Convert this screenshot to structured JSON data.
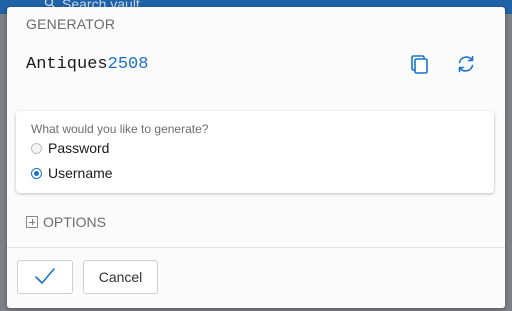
{
  "background": {
    "search_placeholder": "Search vault"
  },
  "dialog": {
    "title": "GENERATOR",
    "generated_value": {
      "word": "Antiques",
      "number": "2508"
    },
    "copy_icon": "copy-icon",
    "regenerate_icon": "refresh-icon",
    "type_question": "What would you like to generate?",
    "types": [
      {
        "label": "Password",
        "selected": false
      },
      {
        "label": "Username",
        "selected": true
      }
    ],
    "options_label": "OPTIONS",
    "options_icon": "plus-square-icon",
    "confirm_icon": "checkmark-icon",
    "cancel_label": "Cancel"
  },
  "colors": {
    "accent": "#1a73c8",
    "header": "#1f62a8"
  }
}
